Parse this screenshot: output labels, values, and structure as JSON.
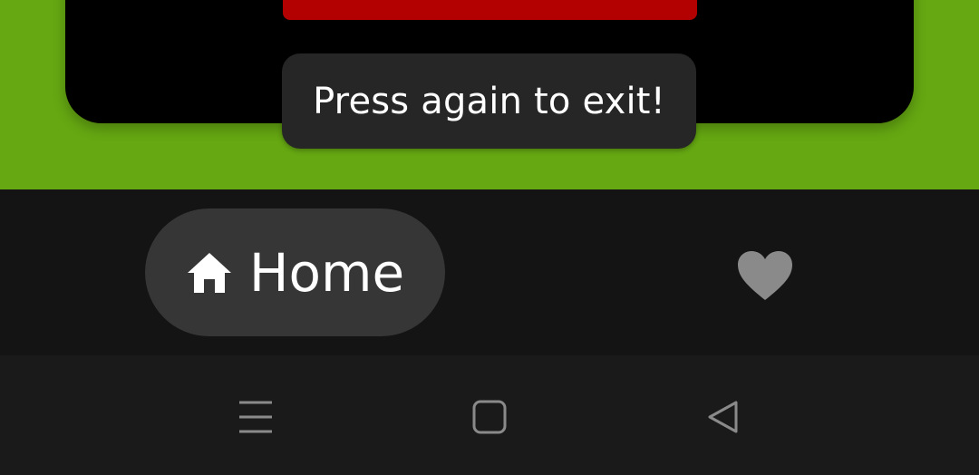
{
  "toast": {
    "message": "Press again to exit!"
  },
  "bottom_nav": {
    "tabs": [
      {
        "label": "Home",
        "icon": "home-icon",
        "selected": true
      },
      {
        "label": "",
        "icon": "heart-icon",
        "selected": false
      }
    ]
  },
  "system_nav": {
    "buttons": [
      {
        "icon": "menu-icon"
      },
      {
        "icon": "square-home-icon"
      },
      {
        "icon": "back-triangle-icon"
      }
    ]
  },
  "colors": {
    "content_background": "#65a812",
    "card": "#000000",
    "red_button": "#b30000",
    "toast_background": "#262626",
    "nav_background": "#141414",
    "selected_pill": "#363636",
    "system_bar": "#1a1a1a",
    "inactive_icon": "#8a8a8a"
  }
}
